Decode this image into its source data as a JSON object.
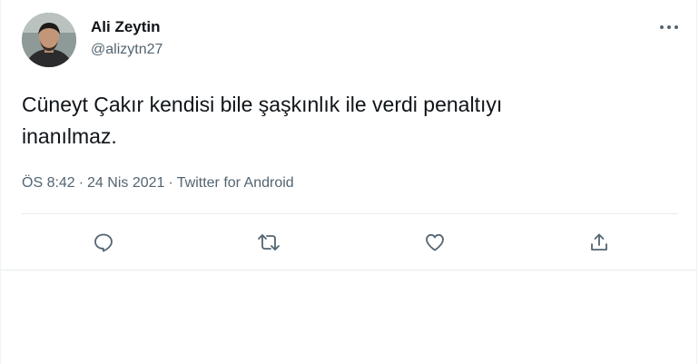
{
  "tweet": {
    "author_name": "Ali Zeytin",
    "author_handle": "@alizytn27",
    "text_line1": "Cüneyt Çakır kendisi bile şaşkınlık ile verdi penaltıyı",
    "text_line2": "inanılmaz.",
    "time": "ÖS 8:42",
    "date": "24 Nis 2021",
    "separator": "·",
    "source": "Twitter for Android"
  },
  "icons": {
    "more": "more-horizontal-icon",
    "reply": "reply-icon",
    "retweet": "retweet-icon",
    "like": "heart-icon",
    "share": "share-icon"
  },
  "colors": {
    "primary_text": "#0f1419",
    "secondary_text": "#536471",
    "divider": "#e7ecf0"
  }
}
